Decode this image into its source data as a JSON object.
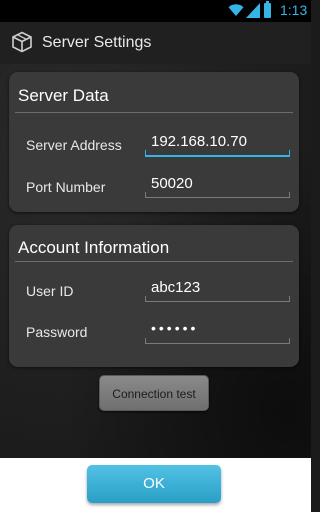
{
  "status_bar": {
    "time": "1:13",
    "icons": [
      "wifi-icon",
      "signal-icon",
      "battery-icon"
    ],
    "accent_color": "#33b5e5"
  },
  "action_bar": {
    "icon": "cube-icon",
    "title": "Server Settings"
  },
  "server_data": {
    "title": "Server Data",
    "server_address_label": "Server Address",
    "server_address_value": "192.168.10.70",
    "port_number_label": "Port Number",
    "port_number_value": "50020"
  },
  "account_information": {
    "title": "Account Information",
    "user_id_label": "User ID",
    "user_id_value": "abc123",
    "password_label": "Password",
    "password_value": "••••••"
  },
  "buttons": {
    "connection_test": "Connection test",
    "ok": "OK"
  },
  "colors": {
    "focus_underline": "#33b5e5",
    "ok_button": "#33a9d3",
    "panel_background": "#3a3a3a"
  }
}
